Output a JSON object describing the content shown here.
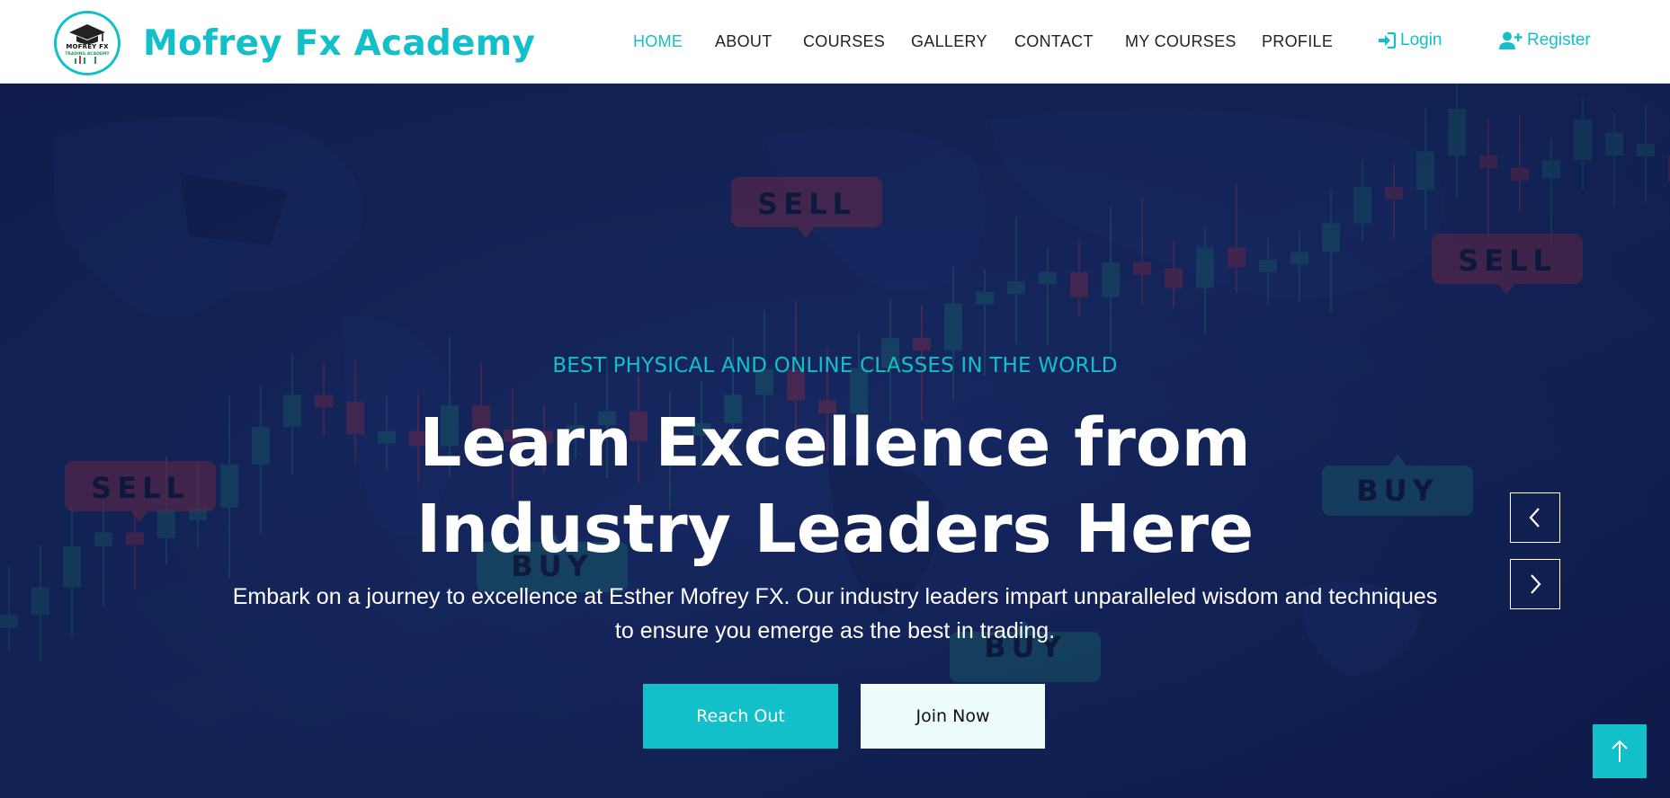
{
  "brand": {
    "logo_line1": "MOFREY FX",
    "logo_line2": "TRADING ACADEMY",
    "name": "Mofrey Fx Academy"
  },
  "nav": {
    "items": [
      {
        "label": "HOME",
        "active": true
      },
      {
        "label": "ABOUT",
        "active": false
      },
      {
        "label": "COURSES",
        "active": false
      },
      {
        "label": "GALLERY",
        "active": false
      },
      {
        "label": "CONTACT",
        "active": false
      },
      {
        "label": "MY COURSES",
        "active": false
      },
      {
        "label": "PROFILE",
        "active": false
      }
    ],
    "login_label": "Login",
    "register_label": "Register"
  },
  "hero": {
    "subtitle": "BEST PHYSICAL AND ONLINE CLASSES IN THE WORLD",
    "title": "Learn Excellence from Industry Leaders Here",
    "description": "Embark on a journey to excellence at Esther Mofrey FX. Our industry leaders impart unparalleled wisdom and techniques to ensure you emerge as the best in trading.",
    "primary_button": "Reach Out",
    "secondary_button": "Join Now",
    "background_tags": [
      "SELL",
      "SELL",
      "SELL",
      "BUY",
      "BUY",
      "BUY"
    ]
  },
  "colors": {
    "accent": "#13bfc9",
    "hero_bg": "#142357",
    "sell_red": "#a8344a",
    "buy_green": "#1e7a78"
  },
  "icons": {
    "login": "sign-in-icon",
    "register": "user-plus-icon",
    "prev": "chevron-left-icon",
    "next": "chevron-right-icon",
    "back_to_top": "arrow-up-icon"
  }
}
